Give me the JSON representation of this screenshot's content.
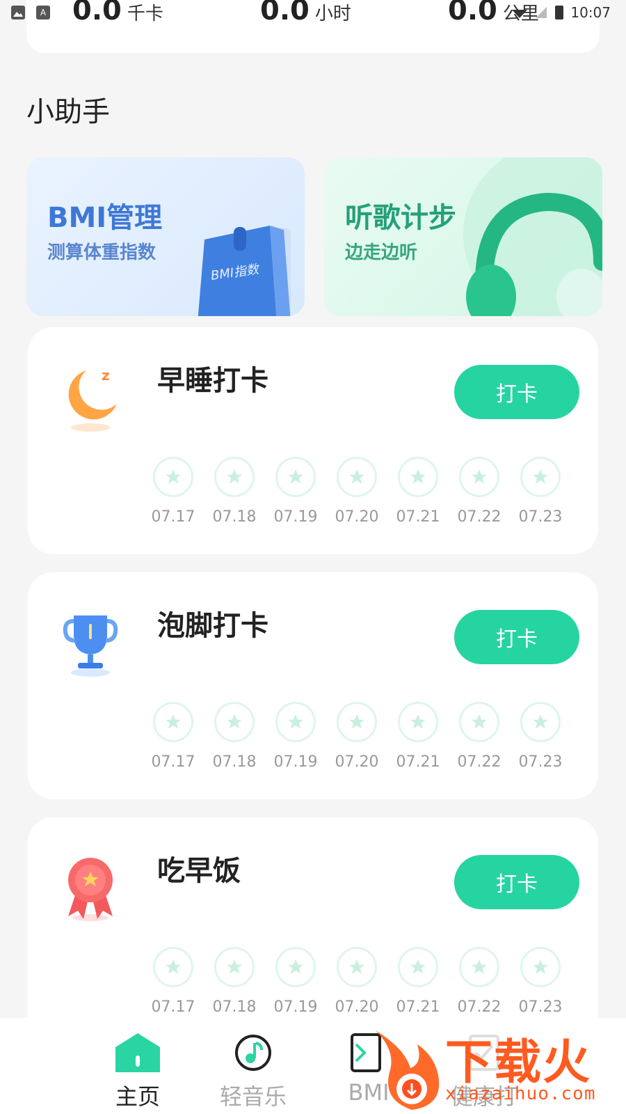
{
  "status_bar": {
    "time": "10:07"
  },
  "stats": [
    {
      "value": "0.0",
      "unit": "千卡"
    },
    {
      "value": "0.0",
      "unit": "小时"
    },
    {
      "value": "0.0",
      "unit": "公里"
    }
  ],
  "section": {
    "title": "小助手"
  },
  "assistants": [
    {
      "title": "BMI管理",
      "subtitle": "测算体重指数",
      "art_label": "BMI指数"
    },
    {
      "title": "听歌计步",
      "subtitle": "边走边听"
    }
  ],
  "checkins": [
    {
      "title": "早睡打卡",
      "button": "打卡",
      "icon": "moon-icon",
      "days": [
        "07.17",
        "07.18",
        "07.19",
        "07.20",
        "07.21",
        "07.22",
        "07.23"
      ]
    },
    {
      "title": "泡脚打卡",
      "button": "打卡",
      "icon": "trophy-icon",
      "days": [
        "07.17",
        "07.18",
        "07.19",
        "07.20",
        "07.21",
        "07.22",
        "07.23"
      ]
    },
    {
      "title": "吃早饭",
      "button": "打卡",
      "icon": "medal-icon",
      "days": [
        "07.17",
        "07.18",
        "07.19",
        "07.20",
        "07.21",
        "07.22",
        "07.23"
      ]
    }
  ],
  "nav": [
    {
      "label": "主页",
      "icon": "home-icon",
      "active": true
    },
    {
      "label": "轻音乐",
      "icon": "music-icon",
      "active": false
    },
    {
      "label": "BMI",
      "icon": "bmi-icon",
      "active": false
    },
    {
      "label": "健康打",
      "icon": "health-icon",
      "active": false
    }
  ],
  "watermark": {
    "text": "下载火",
    "url": "xiazaihuo.com"
  },
  "colors": {
    "accent": "#26d4a2",
    "background": "#f5f5f5",
    "star": "#c9f0df"
  }
}
